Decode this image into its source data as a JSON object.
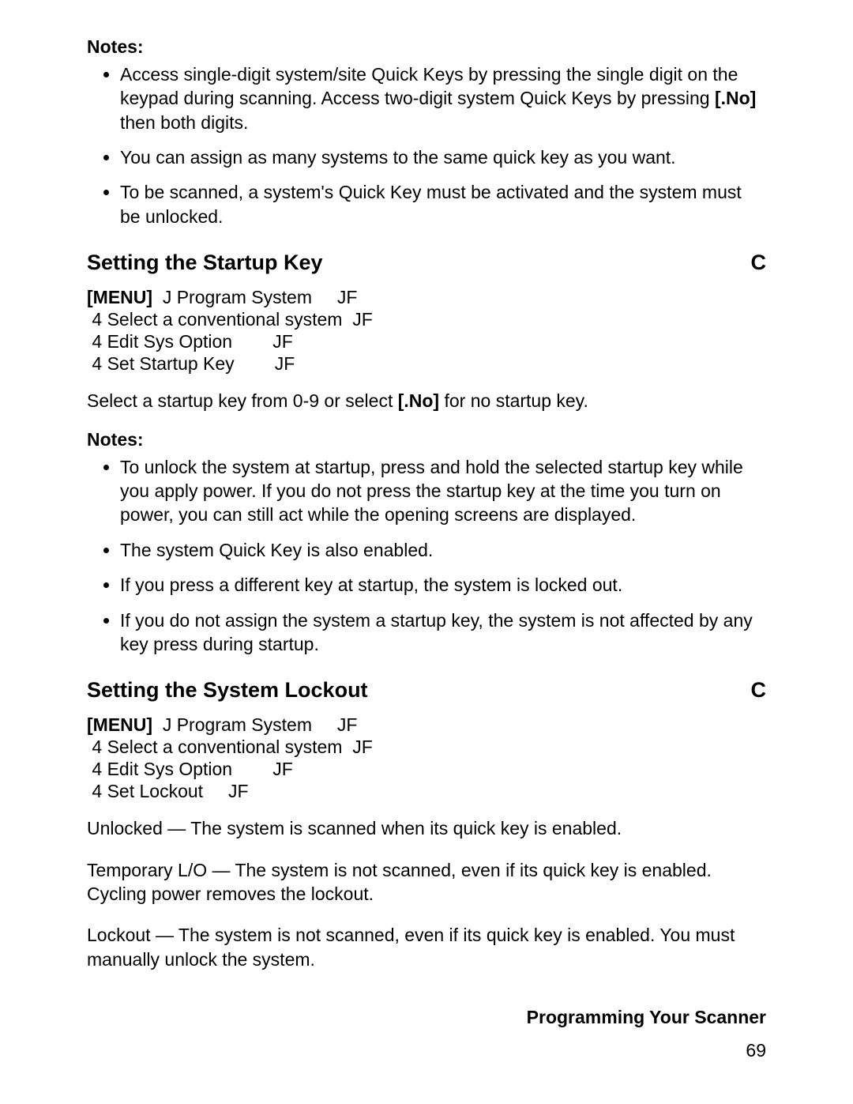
{
  "notes1": {
    "heading": "Notes:",
    "items": [
      {
        "pre": "Access single-digit system/site Quick Keys by pressing the single digit on the keypad during scanning. Access two-digit system Quick Keys by pressing ",
        "bold": "[.No]",
        "post": " then both digits."
      },
      {
        "pre": "You can assign as many systems to the same quick key as you want.",
        "bold": "",
        "post": ""
      },
      {
        "pre": "To be scanned, a system's Quick Key must be activated and the system must be unlocked.",
        "bold": "",
        "post": ""
      }
    ]
  },
  "section1": {
    "title": "Setting the Startup Key",
    "marker": "C",
    "menu_label": "[MENU]",
    "steps": [
      {
        "indent": "",
        "prefix": "",
        "step": "J Program System",
        "suffix": "     JF"
      },
      {
        "indent": " ",
        "prefix": "4 ",
        "step": "Select a conventional system",
        "suffix": "  JF"
      },
      {
        "indent": " ",
        "prefix": "4 ",
        "step": "Edit Sys Option",
        "suffix": "        JF"
      },
      {
        "indent": " ",
        "prefix": "4 ",
        "step": "Set Startup Key",
        "suffix": "        JF"
      }
    ],
    "para_pre": "Select a startup key from 0-9 or select ",
    "para_bold": "[.No]",
    "para_post": " for no startup key."
  },
  "notes2": {
    "heading": "Notes:",
    "items": [
      "To unlock the system at startup, press and hold the selected startup key while you apply power. If you do not press the startup key at the time you turn on power, you can still act while the opening screens are displayed.",
      "The system Quick Key is also enabled.",
      "If you press a different key at startup, the system is locked out.",
      "If you do not assign the system a startup key, the system is not affected by any key press during startup."
    ]
  },
  "section2": {
    "title": "Setting the System Lockout",
    "marker": "C",
    "menu_label": "[MENU]",
    "steps": [
      {
        "indent": "",
        "prefix": "",
        "step": "J Program System",
        "suffix": "     JF"
      },
      {
        "indent": " ",
        "prefix": "4 ",
        "step": "Select a conventional system",
        "suffix": "  JF"
      },
      {
        "indent": " ",
        "prefix": "4 ",
        "step": "Edit Sys Option",
        "suffix": "        JF"
      },
      {
        "indent": " ",
        "prefix": "4 ",
        "step": "Set Lockout",
        "suffix": "     JF"
      }
    ],
    "defs": [
      "Unlocked   — The system is scanned when its quick key is enabled.",
      "Temporary L/O    — The system is not scanned, even if its quick key is enabled. Cycling power removes the lockout.",
      "Lockout   — The system is not scanned, even if its quick key is enabled. You must manually unlock the system."
    ]
  },
  "footer": {
    "title": "Programming Your Scanner",
    "page": "69"
  }
}
